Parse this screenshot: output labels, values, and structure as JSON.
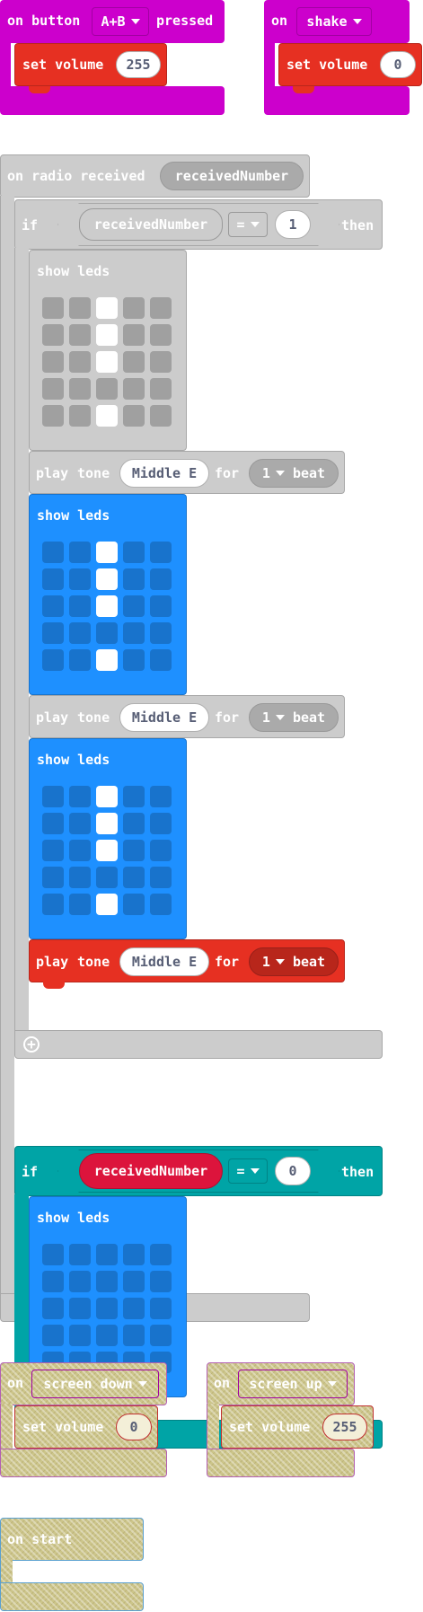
{
  "colors": {
    "event_magenta": "#cc00cc",
    "music_red": "#e63022",
    "logic_teal": "#00a4a6",
    "basic_blue": "#1e90ff",
    "disabled_gray": "#cccccc",
    "variable_red": "#dc143c",
    "led_on": "#ffffff"
  },
  "icons": {
    "dropdown": "caret-down",
    "add": "plus-circle"
  },
  "blocks": {
    "on_button": {
      "prefix": "on button",
      "button": "A+B",
      "suffix": "pressed",
      "set_volume": "set volume",
      "volume": "255"
    },
    "on_shake": {
      "prefix": "on",
      "gesture": "shake",
      "set_volume": "set volume",
      "volume": "0"
    },
    "on_radio": {
      "header": "on radio received",
      "param": "receivedNumber",
      "if1": {
        "if": "if",
        "var": "receivedNumber",
        "op": "=",
        "value": "1",
        "then": "then"
      },
      "show_leds_1": {
        "label": "show leds",
        "grid": [
          [
            0,
            0,
            1,
            0,
            0
          ],
          [
            0,
            0,
            1,
            0,
            0
          ],
          [
            0,
            0,
            1,
            0,
            0
          ],
          [
            0,
            0,
            0,
            0,
            0
          ],
          [
            0,
            0,
            1,
            0,
            0
          ]
        ]
      },
      "tone_1": {
        "play": "play",
        "tone": "tone",
        "note": "Middle E",
        "for": "for",
        "beat_count": "1",
        "beat": "beat"
      },
      "show_leds_2": {
        "label": "show leds",
        "grid": [
          [
            0,
            0,
            1,
            0,
            0
          ],
          [
            0,
            0,
            1,
            0,
            0
          ],
          [
            0,
            0,
            1,
            0,
            0
          ],
          [
            0,
            0,
            0,
            0,
            0
          ],
          [
            0,
            0,
            1,
            0,
            0
          ]
        ]
      },
      "tone_2": {
        "play": "play",
        "tone": "tone",
        "note": "Middle E",
        "for": "for",
        "beat_count": "1",
        "beat": "beat"
      },
      "show_leds_3": {
        "label": "show leds",
        "grid": [
          [
            0,
            0,
            1,
            0,
            0
          ],
          [
            0,
            0,
            1,
            0,
            0
          ],
          [
            0,
            0,
            1,
            0,
            0
          ],
          [
            0,
            0,
            0,
            0,
            0
          ],
          [
            0,
            0,
            1,
            0,
            0
          ]
        ]
      },
      "tone_3": {
        "play": "play",
        "tone": "tone",
        "note": "Middle E",
        "for": "for",
        "beat_count": "1",
        "beat": "beat"
      },
      "if2": {
        "if": "if",
        "var": "receivedNumber",
        "op": "=",
        "value": "0",
        "then": "then"
      },
      "show_leds_4": {
        "label": "show leds",
        "grid": [
          [
            0,
            0,
            0,
            0,
            0
          ],
          [
            0,
            0,
            0,
            0,
            0
          ],
          [
            0,
            0,
            0,
            0,
            0
          ],
          [
            0,
            0,
            0,
            0,
            0
          ],
          [
            0,
            0,
            0,
            0,
            0
          ]
        ]
      }
    },
    "on_screen_down": {
      "prefix": "on",
      "gesture": "screen down",
      "set_volume": "set volume",
      "volume": "0"
    },
    "on_screen_up": {
      "prefix": "on",
      "gesture": "screen up",
      "set_volume": "set volume",
      "volume": "255"
    },
    "on_start": {
      "label": "on start"
    }
  }
}
